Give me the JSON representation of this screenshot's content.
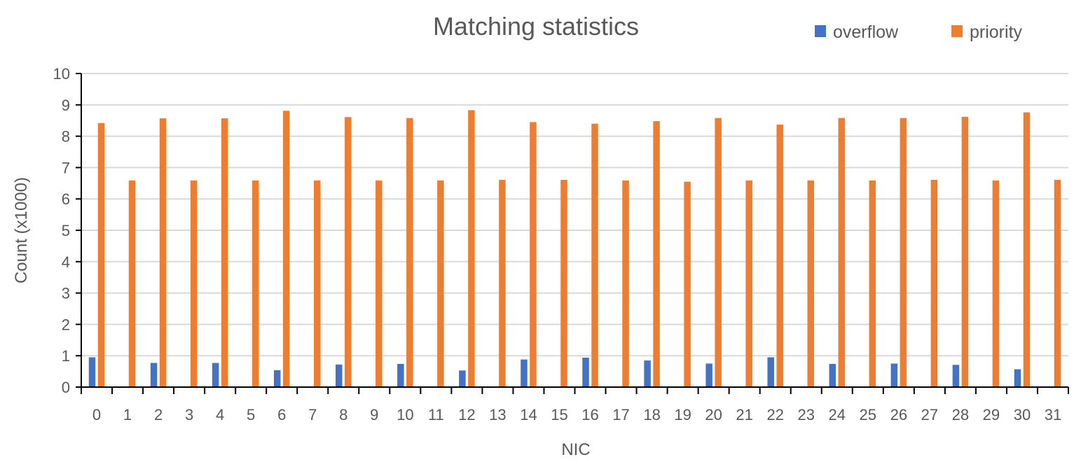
{
  "chart_data": {
    "type": "bar",
    "title": "Matching statistics",
    "xlabel": "NIC",
    "ylabel": "Count (x1000)",
    "ylim": [
      0,
      10
    ],
    "yticks": [
      "0",
      "1",
      "2",
      "3",
      "4",
      "5",
      "6",
      "7",
      "8",
      "9",
      "10"
    ],
    "grid": true,
    "legend_position": "top-right",
    "categories": [
      "0",
      "1",
      "2",
      "3",
      "4",
      "5",
      "6",
      "7",
      "8",
      "9",
      "10",
      "11",
      "12",
      "13",
      "14",
      "15",
      "16",
      "17",
      "18",
      "19",
      "20",
      "21",
      "22",
      "23",
      "24",
      "25",
      "26",
      "27",
      "28",
      "29",
      "30",
      "31"
    ],
    "series": [
      {
        "name": "overflow",
        "color": "#4472C4",
        "values": [
          0.95,
          0,
          0.77,
          0,
          0.77,
          0,
          0.54,
          0,
          0.72,
          0,
          0.74,
          0,
          0.53,
          0,
          0.88,
          0,
          0.94,
          0,
          0.85,
          0.02,
          0.75,
          0,
          0.95,
          0,
          0.74,
          0,
          0.75,
          0,
          0.71,
          0,
          0.57,
          0
        ]
      },
      {
        "name": "priority",
        "color": "#ED7D31",
        "values": [
          8.42,
          6.59,
          8.57,
          6.59,
          8.57,
          6.59,
          8.81,
          6.59,
          8.61,
          6.59,
          8.58,
          6.59,
          8.83,
          6.61,
          8.45,
          6.61,
          8.4,
          6.59,
          8.48,
          6.55,
          8.58,
          6.59,
          8.37,
          6.59,
          8.58,
          6.59,
          8.58,
          6.61,
          8.62,
          6.59,
          8.76,
          6.61
        ]
      }
    ]
  }
}
